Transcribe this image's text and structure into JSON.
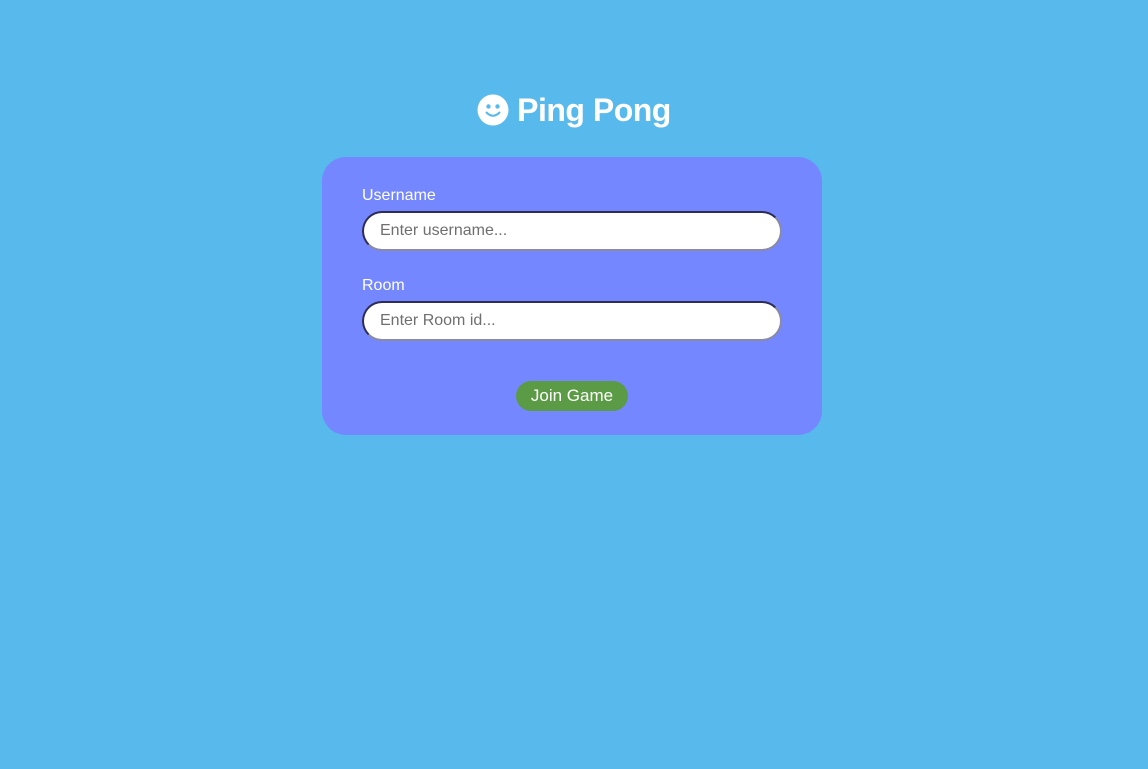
{
  "header": {
    "icon": "smiley-face-icon",
    "title": "Ping Pong"
  },
  "form": {
    "username": {
      "label": "Username",
      "placeholder": "Enter username...",
      "value": ""
    },
    "room": {
      "label": "Room",
      "placeholder": "Enter Room id...",
      "value": ""
    },
    "submit_label": "Join Game"
  },
  "colors": {
    "background": "#58b9ec",
    "card": "#7487ff",
    "button": "#5b9b46",
    "text": "#ffffff"
  }
}
